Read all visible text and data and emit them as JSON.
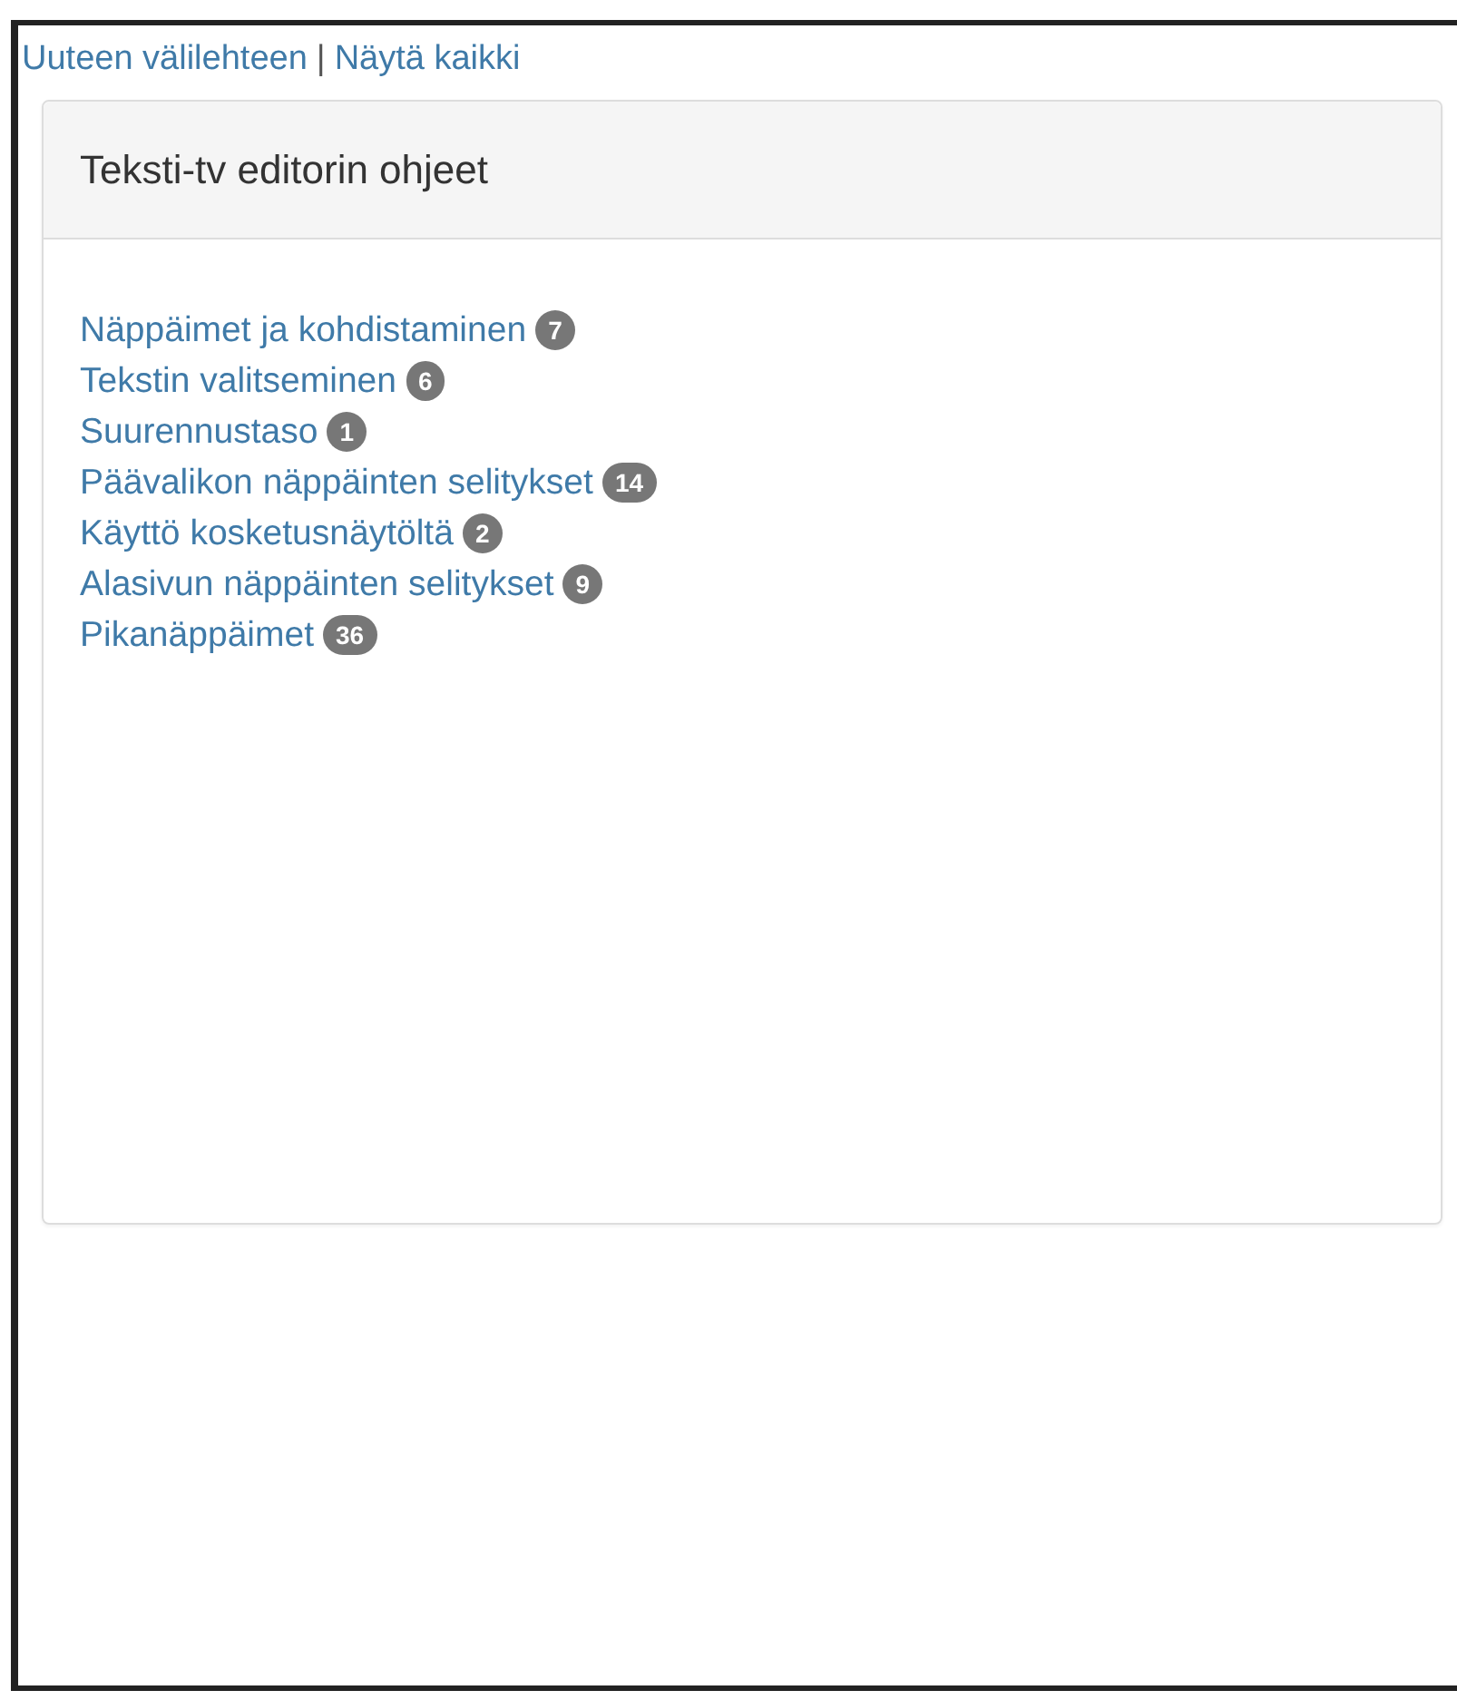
{
  "top_links": {
    "items": [
      "Uuteen välilehteen",
      "Näytä kaikki"
    ],
    "separator": "|"
  },
  "panel": {
    "title": "Teksti-tv editorin ohjeet",
    "items": [
      {
        "label": "Näppäimet ja kohdistaminen",
        "count": "7"
      },
      {
        "label": "Tekstin valitseminen",
        "count": "6"
      },
      {
        "label": "Suurennustaso",
        "count": "1"
      },
      {
        "label": "Päävalikon näppäinten selitykset",
        "count": "14"
      },
      {
        "label": "Käyttö kosketusnäytöltä",
        "count": "2"
      },
      {
        "label": "Alasivun näppäinten selitykset",
        "count": "9"
      },
      {
        "label": "Pikanäppäimet",
        "count": "36"
      }
    ]
  }
}
